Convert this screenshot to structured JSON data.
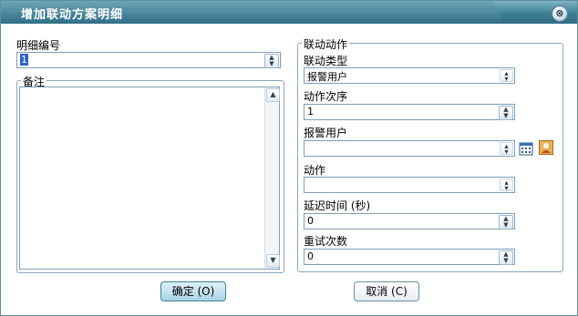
{
  "window": {
    "title": "增加联动方案明细",
    "close_glyph": "⊗"
  },
  "detail_number": {
    "label": "明细编号",
    "value": "1"
  },
  "remarks": {
    "label": "备注",
    "value": ""
  },
  "linkage_action": {
    "group_label": "联动动作",
    "linkage_type": {
      "label": "联动类型",
      "value": "报警用户"
    },
    "action_order": {
      "label": "动作次序",
      "value": "1"
    },
    "alarm_user": {
      "label": "报警用户",
      "value": ""
    },
    "action": {
      "label": "动作",
      "value": ""
    },
    "delay_time": {
      "label": "延迟时间 (秒)",
      "value": "0"
    },
    "retry_count": {
      "label": "重试次数",
      "value": "0"
    }
  },
  "buttons": {
    "ok": "确定 (O)",
    "cancel": "取消 (C)"
  },
  "icons": {
    "calendar": "calendar-icon",
    "user_lookup": "user-lookup-icon"
  }
}
